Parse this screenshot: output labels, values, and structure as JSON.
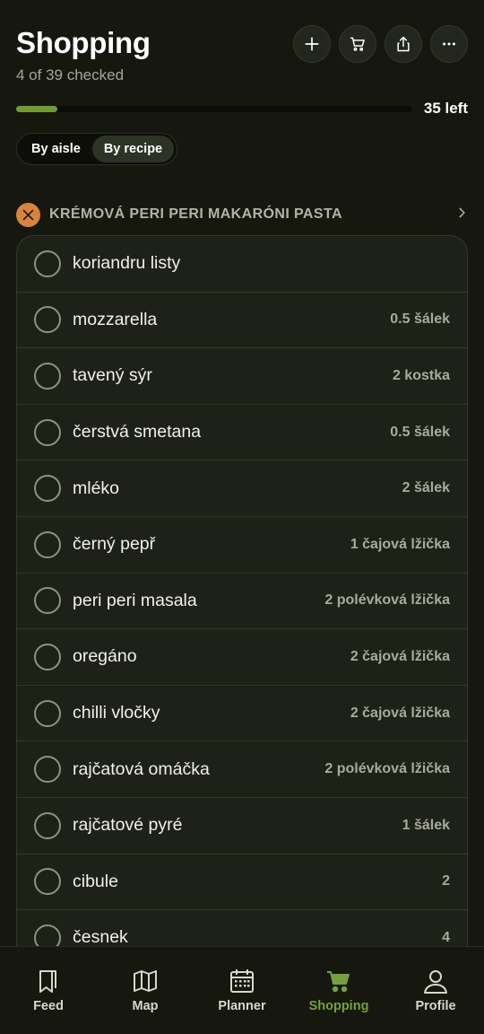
{
  "header": {
    "title": "Shopping",
    "subtitle": "4 of 39 checked",
    "actions": [
      {
        "name": "add-button",
        "icon": "plus-icon"
      },
      {
        "name": "cart-button",
        "icon": "cart-icon"
      },
      {
        "name": "share-button",
        "icon": "share-icon"
      },
      {
        "name": "more-button",
        "icon": "more-horizontal-icon"
      }
    ]
  },
  "progress": {
    "checked": 4,
    "total": 39,
    "fraction": 0.103,
    "left_label": "35 left"
  },
  "view_toggle": {
    "options": [
      "By aisle",
      "By recipe"
    ],
    "selected": "By recipe"
  },
  "recipe": {
    "icon": "utensils-icon",
    "title": "KRÉMOVÁ PERI PERI MAKARÓNI PASTA",
    "items": [
      {
        "name": "koriandru listy",
        "qty": ""
      },
      {
        "name": "mozzarella",
        "qty": "0.5 šálek"
      },
      {
        "name": "tavený sýr",
        "qty": "2 kostka"
      },
      {
        "name": "čerstvá smetana",
        "qty": "0.5 šálek"
      },
      {
        "name": "mléko",
        "qty": "2 šálek"
      },
      {
        "name": "černý pepř",
        "qty": "1 čajová lžička"
      },
      {
        "name": "peri peri masala",
        "qty": "2 polévková lžička"
      },
      {
        "name": "oregáno",
        "qty": "2 čajová lžička"
      },
      {
        "name": "chilli vločky",
        "qty": "2 čajová lžička"
      },
      {
        "name": "rajčatová omáčka",
        "qty": "2 polévková lžička"
      },
      {
        "name": "rajčatové pyré",
        "qty": "1 šálek"
      },
      {
        "name": "cibule",
        "qty": "2"
      },
      {
        "name": "česnek",
        "qty": "4"
      }
    ]
  },
  "nav": {
    "items": [
      {
        "label": "Feed",
        "icon": "bookmark-icon"
      },
      {
        "label": "Map",
        "icon": "map-icon"
      },
      {
        "label": "Planner",
        "icon": "calendar-icon"
      },
      {
        "label": "Shopping",
        "icon": "cart-icon"
      },
      {
        "label": "Profile",
        "icon": "profile-icon"
      }
    ],
    "active": "Shopping"
  },
  "colors": {
    "background": "#161810",
    "accent": "#76a03c",
    "card": "#1e2118",
    "recipe_icon": "#d8843d"
  }
}
